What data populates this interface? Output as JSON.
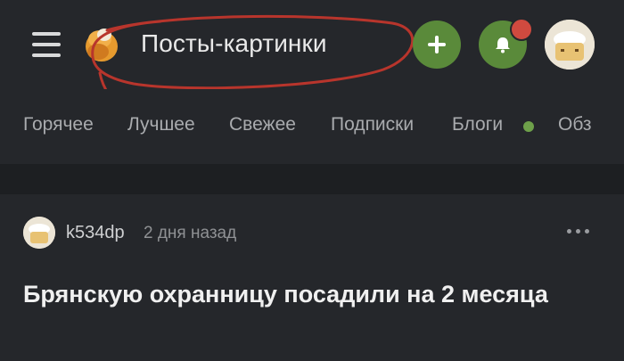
{
  "header": {
    "title": "Посты-картинки",
    "menu_icon": "hamburger-menu-icon",
    "logo_icon": "pikabu-logo-icon",
    "add_icon": "plus-icon",
    "bell_icon": "bell-icon",
    "accent_color": "#5a8a3a",
    "notification_color": "#d04a3f"
  },
  "tabs": [
    {
      "label": "Горячее"
    },
    {
      "label": "Лучшее"
    },
    {
      "label": "Свежее"
    },
    {
      "label": "Подписки"
    },
    {
      "label": "Блоги"
    },
    {
      "label": "Обз"
    }
  ],
  "post": {
    "author": "k534dp",
    "time": "2 дня назад",
    "title": "Брянскую охранницу посадили на 2 месяца",
    "more_icon": "more-dots-icon"
  }
}
